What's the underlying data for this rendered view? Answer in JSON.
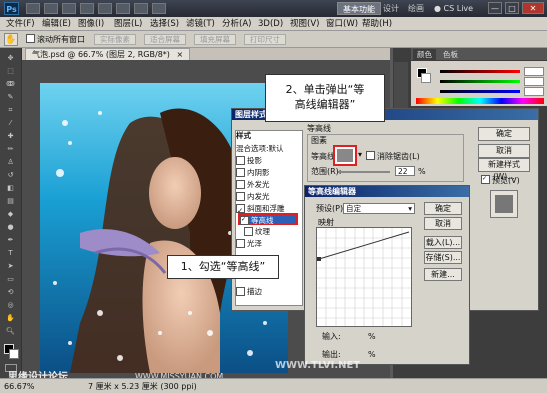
{
  "titlebar": {
    "logo": "Ps",
    "workspaces": [
      "基本功能",
      "设计",
      "绘画"
    ],
    "cs_live": "CS Live",
    "window_controls": [
      "—",
      "□",
      "✕"
    ]
  },
  "menubar": [
    "文件(F)",
    "编辑(E)",
    "图像(I)",
    "图层(L)",
    "选择(S)",
    "滤镜(T)",
    "分析(A)",
    "3D(D)",
    "视图(V)",
    "窗口(W)",
    "帮助(H)"
  ],
  "options": {
    "checkbox_label": "滚动所有窗口",
    "buttons": [
      "实际像素",
      "适合屏幕",
      "填充屏幕",
      "打印尺寸"
    ]
  },
  "document": {
    "tab_label": "气泡.psd @ 66.7% (图层 2, RGB/8*)",
    "tab_close": "×"
  },
  "panels": {
    "tabs": [
      "颜色",
      "色板"
    ]
  },
  "layer_style": {
    "title": "图层样式",
    "list_header": "样式",
    "list_items": [
      "混合选项:默认",
      "投影",
      "内阴影",
      "外发光",
      "内发光",
      "斜面和浮雕",
      "等高线",
      "纹理",
      "光泽",
      "颜色叠加",
      "渐变叠加",
      "图案叠加",
      "描边"
    ],
    "checked": [
      "斜面和浮雕",
      "等高线"
    ],
    "section_title": "等高线",
    "group_title": "图素",
    "contour_label": "等高线:",
    "antialias_label": "消除锯齿(L)",
    "range_label": "范围(R):",
    "range_value": "22",
    "range_unit": "%",
    "buttons": [
      "确定",
      "取消",
      "新建样式(W)...",
      "预览(V)"
    ]
  },
  "contour_editor": {
    "title": "等高线编辑器",
    "preset_label": "预设(P):",
    "preset_value": "自定",
    "mapping_title": "映射",
    "input_label": "输入:",
    "output_label": "输出:",
    "percent": "%",
    "buttons": [
      "确定",
      "取消",
      "载入(L)...",
      "存储(S)...",
      "新建..."
    ]
  },
  "callouts": {
    "step1": "1、勾选“等高线”",
    "step2_line1": "2、单击弹出“等",
    "step2_line2": "高线编辑器”"
  },
  "statusbar": {
    "zoom": "66.67%",
    "doc_size": "7 厘米 x 5.23 厘米 (300 ppi)"
  },
  "watermarks": [
    "思缘设计论坛",
    "WWW.MISSYUAN.COM",
    "WWW.TLVI.NET"
  ]
}
